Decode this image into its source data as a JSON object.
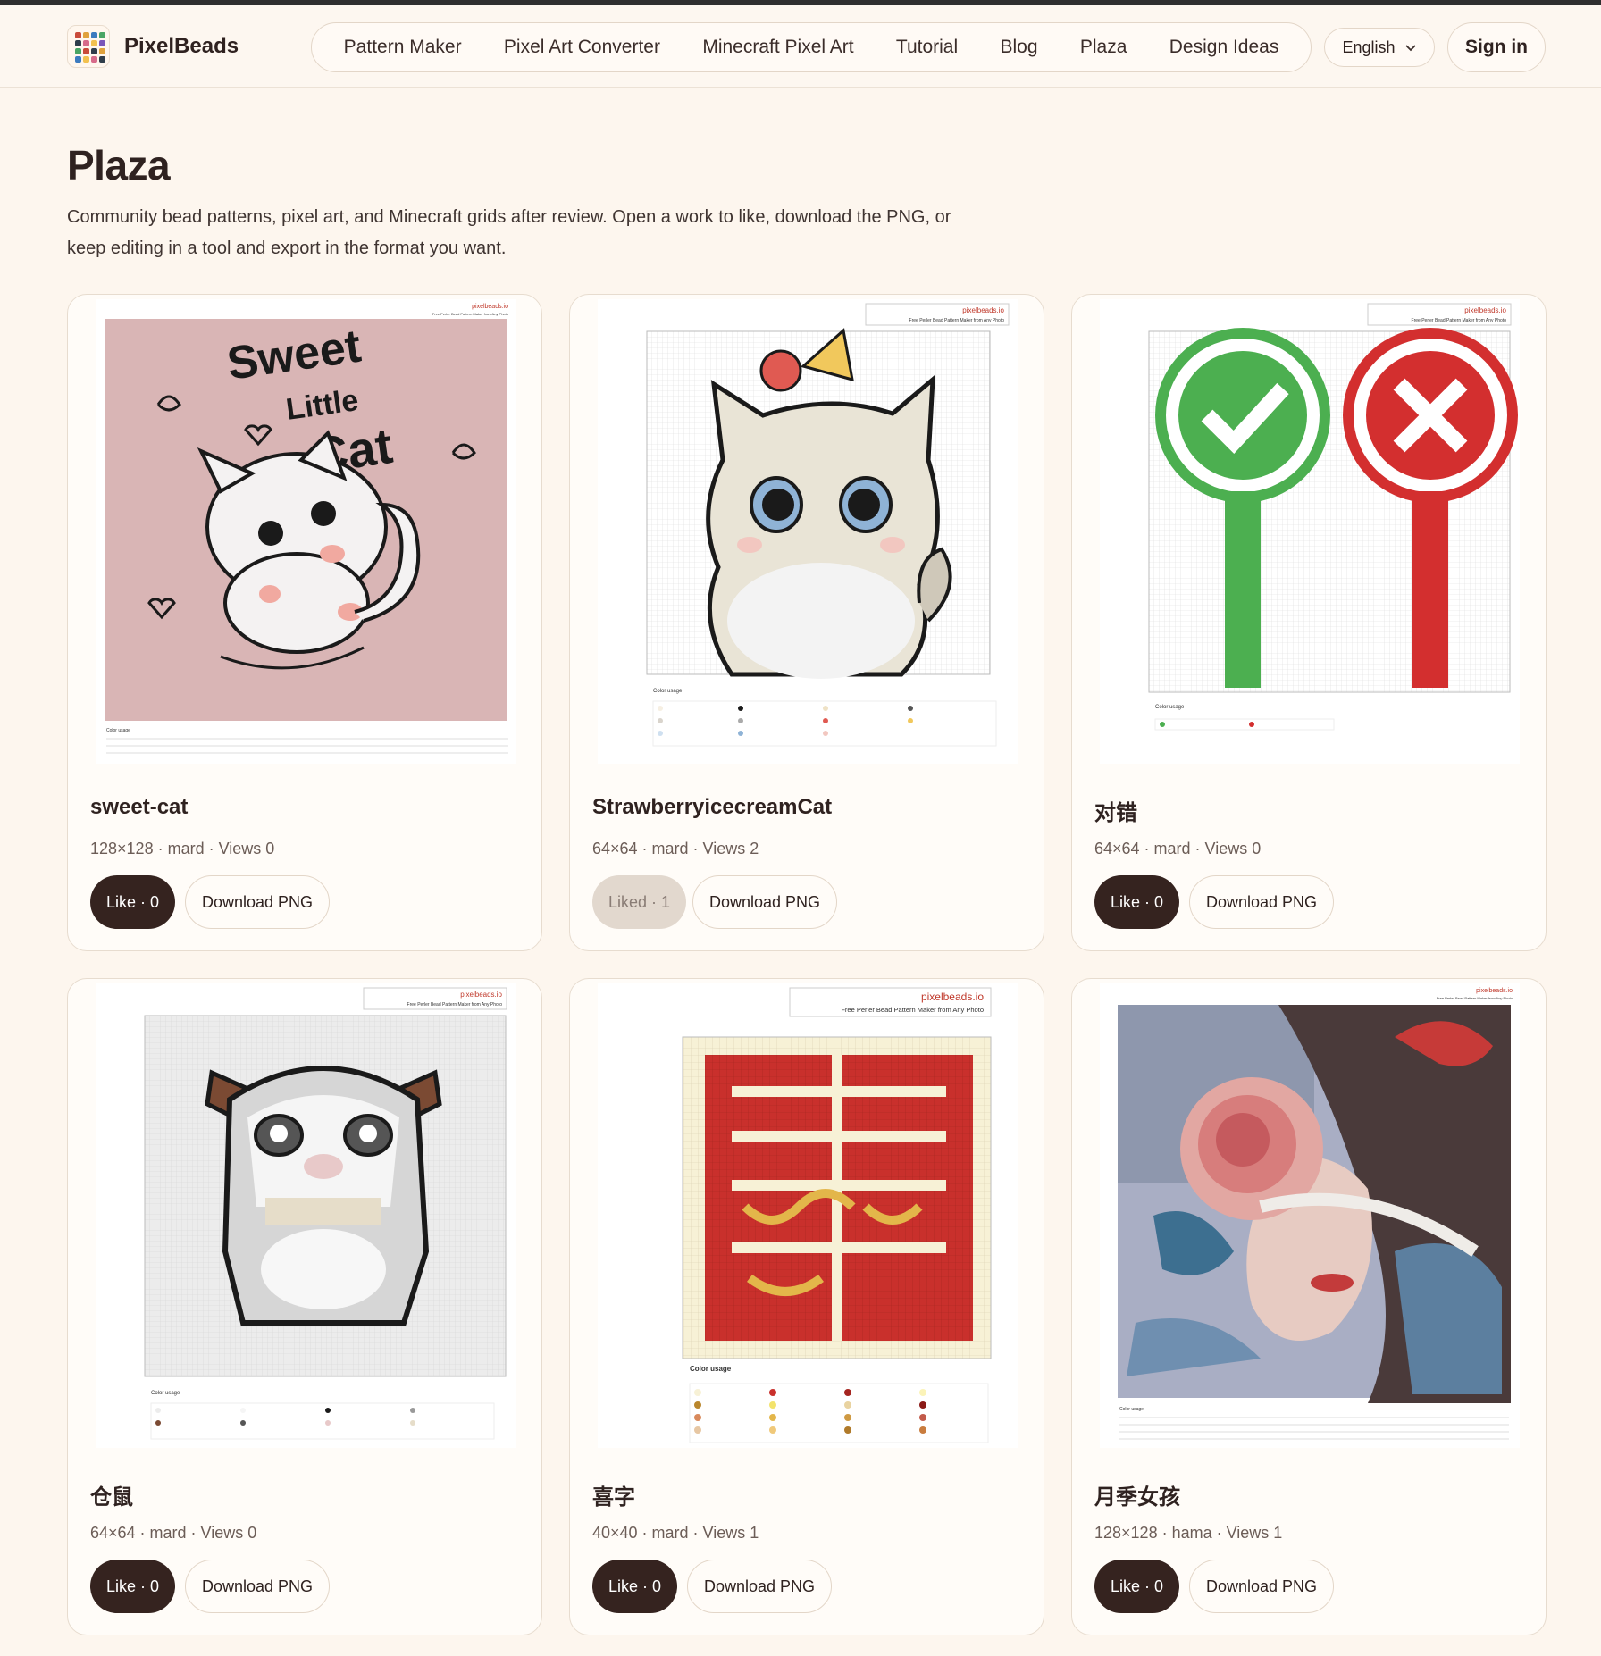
{
  "brand": {
    "name": "PixelBeads"
  },
  "nav": {
    "items": [
      "Pattern Maker",
      "Pixel Art Converter",
      "Minecraft Pixel Art",
      "Tutorial",
      "Blog",
      "Plaza",
      "Design Ideas"
    ],
    "language": "English",
    "signin": "Sign in"
  },
  "page": {
    "title": "Plaza",
    "description": "Community bead patterns, pixel art, and Minecraft grids after review. Open a work to like, download the PNG, or keep editing in a tool and export in the format you want."
  },
  "preview": {
    "watermark_site": "pixelbeads.io",
    "watermark_tagline": "Free Perler Bead Pattern Maker from Any Photo",
    "color_usage": "Color usage"
  },
  "cards": [
    {
      "title": "sweet-cat",
      "meta": "128×128 · mard · Views 0",
      "like": "Like · 0",
      "liked": false,
      "download": "Download PNG",
      "art_text": [
        "Sweet",
        "Little",
        "Cat"
      ]
    },
    {
      "title": "StrawberryicecreamCat",
      "meta": "64×64 · mard · Views 2",
      "like": "Liked · 1",
      "liked": true,
      "download": "Download PNG"
    },
    {
      "title": "对错",
      "meta": "64×64 · mard · Views 0",
      "like": "Like · 0",
      "liked": false,
      "download": "Download PNG"
    },
    {
      "title": "仓鼠",
      "meta": "64×64 · mard · Views 0",
      "like": "Like · 0",
      "liked": false,
      "download": "Download PNG"
    },
    {
      "title": "喜字",
      "meta": "40×40 · mard · Views 1",
      "like": "Like · 0",
      "liked": false,
      "download": "Download PNG"
    },
    {
      "title": "月季女孩",
      "meta": "128×128 · hama · Views 1",
      "like": "Like · 0",
      "liked": false,
      "download": "Download PNG"
    }
  ],
  "colors": {
    "accent_dark": "#35231f",
    "background": "#fdf6ee",
    "watermark_red": "#c0392b"
  }
}
